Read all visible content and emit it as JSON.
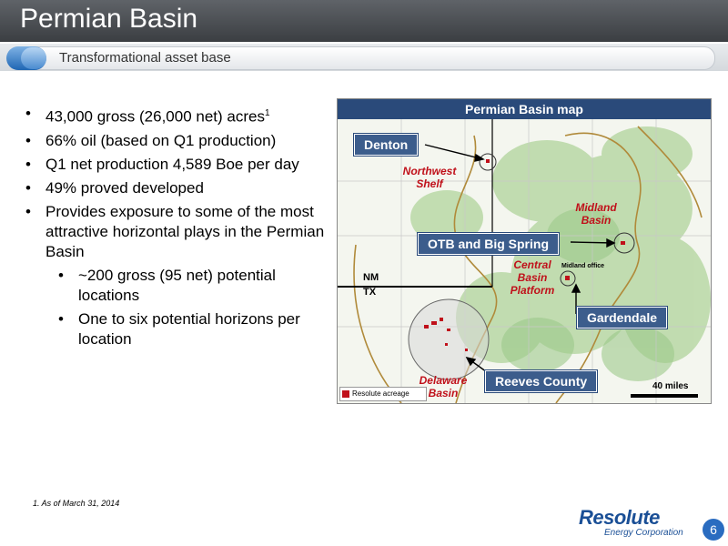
{
  "slide": {
    "title": "Permian Basin",
    "subtitle": "Transformational asset base"
  },
  "bullets": [
    {
      "text": "43,000 gross (26,000 net) acres",
      "sup": "1"
    },
    {
      "text": "66% oil (based on Q1 production)"
    },
    {
      "text": "Q1 net production 4,589 Boe per day"
    },
    {
      "text": "49% proved developed"
    },
    {
      "text": "Provides exposure to some of the most attractive horizontal plays in the Permian Basin"
    }
  ],
  "sub_bullets": [
    {
      "text": "~200 gross (95 net) potential locations"
    },
    {
      "text": "One to six potential horizons per location"
    }
  ],
  "map": {
    "header": "Permian Basin map",
    "callouts": {
      "denton": "Denton",
      "otb": "OTB and Big Spring",
      "gardendale": "Gardendale",
      "reeves": "Reeves County"
    },
    "regions": {
      "northwest_shelf": "Northwest Shelf",
      "midland_basin": "Midland Basin",
      "central_basin": "Central Basin Platform",
      "delaware_basin": "Delaware Basin"
    },
    "state_nm": "NM",
    "state_tx": "TX",
    "midland_office": "Midland office",
    "legend": "Resolute acreage",
    "scale": "40 miles",
    "colors": {
      "acreage": "#c0101a",
      "basin_outline": "#b08a3a",
      "callout": "#3c5d8c"
    }
  },
  "footnote": "1.   As of March 31, 2014",
  "logo": {
    "name": "Resolute",
    "sub": "Energy Corporation"
  },
  "page_number": "6"
}
